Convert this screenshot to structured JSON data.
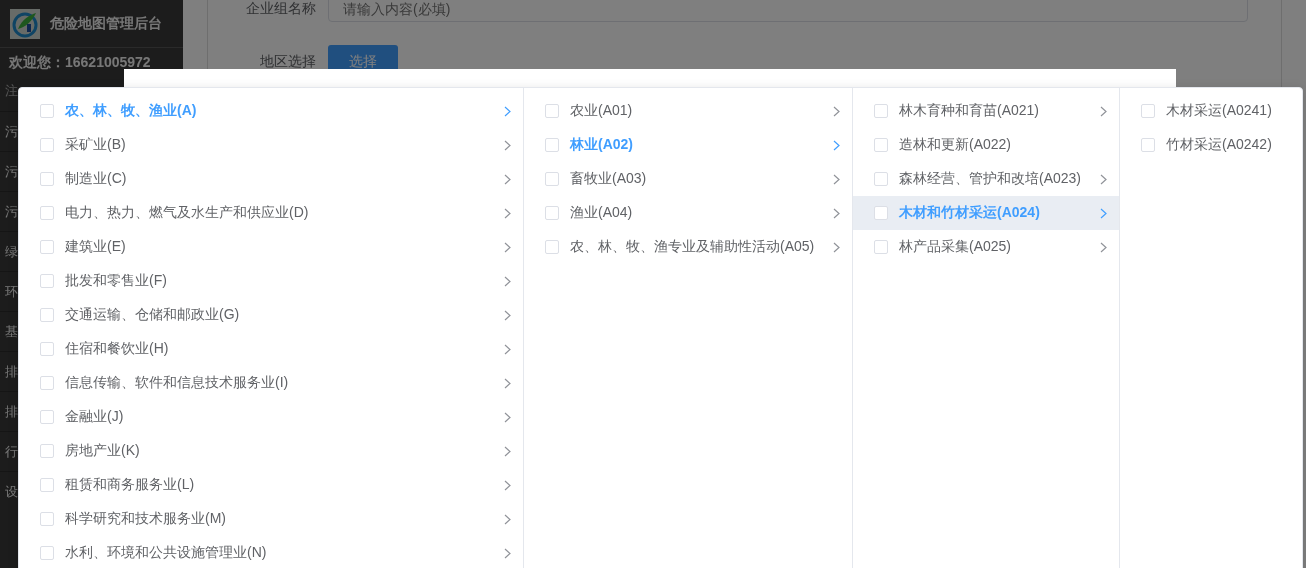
{
  "sidebar": {
    "title": "危险地图管理后台",
    "welcome": "欢迎您：16621005972",
    "note": "注",
    "items": [
      "污",
      "污",
      "污",
      "绿",
      "环",
      "基",
      "排",
      "排",
      "行",
      "设"
    ]
  },
  "form": {
    "name_label": "企业组名称",
    "name_placeholder": "请输入内容(必填)",
    "region_label": "地区选择",
    "region_button": "选择"
  },
  "cascader": {
    "columns": [
      [
        {
          "label": "农、林、牧、渔业(A)",
          "kind": "branch",
          "checked": false,
          "expanded": true,
          "highlighted": false
        },
        {
          "label": "采矿业(B)",
          "kind": "branch",
          "checked": false,
          "expanded": false,
          "highlighted": false
        },
        {
          "label": "制造业(C)",
          "kind": "branch",
          "checked": false,
          "expanded": false,
          "highlighted": false
        },
        {
          "label": "电力、热力、燃气及水生产和供应业(D)",
          "kind": "branch",
          "checked": false,
          "expanded": false,
          "highlighted": false
        },
        {
          "label": "建筑业(E)",
          "kind": "branch",
          "checked": false,
          "expanded": false,
          "highlighted": false
        },
        {
          "label": "批发和零售业(F)",
          "kind": "branch",
          "checked": false,
          "expanded": false,
          "highlighted": false
        },
        {
          "label": "交通运输、仓储和邮政业(G)",
          "kind": "branch",
          "checked": false,
          "expanded": false,
          "highlighted": false
        },
        {
          "label": "住宿和餐饮业(H)",
          "kind": "branch",
          "checked": false,
          "expanded": false,
          "highlighted": false
        },
        {
          "label": "信息传输、软件和信息技术服务业(I)",
          "kind": "branch",
          "checked": false,
          "expanded": false,
          "highlighted": false
        },
        {
          "label": "金融业(J)",
          "kind": "branch",
          "checked": false,
          "expanded": false,
          "highlighted": false
        },
        {
          "label": "房地产业(K)",
          "kind": "branch",
          "checked": false,
          "expanded": false,
          "highlighted": false
        },
        {
          "label": "租赁和商务服务业(L)",
          "kind": "branch",
          "checked": false,
          "expanded": false,
          "highlighted": false
        },
        {
          "label": "科学研究和技术服务业(M)",
          "kind": "branch",
          "checked": false,
          "expanded": false,
          "highlighted": false
        },
        {
          "label": "水利、环境和公共设施管理业(N)",
          "kind": "branch",
          "checked": false,
          "expanded": false,
          "highlighted": false
        }
      ],
      [
        {
          "label": "农业(A01)",
          "kind": "branch",
          "checked": false,
          "expanded": false,
          "highlighted": false
        },
        {
          "label": "林业(A02)",
          "kind": "branch",
          "checked": false,
          "expanded": true,
          "highlighted": false
        },
        {
          "label": "畜牧业(A03)",
          "kind": "branch",
          "checked": false,
          "expanded": false,
          "highlighted": false
        },
        {
          "label": "渔业(A04)",
          "kind": "branch",
          "checked": false,
          "expanded": false,
          "highlighted": false
        },
        {
          "label": "农、林、牧、渔专业及辅助性活动(A05)",
          "kind": "branch",
          "checked": false,
          "expanded": false,
          "highlighted": false
        }
      ],
      [
        {
          "label": "林木育种和育苗(A021)",
          "kind": "branch",
          "checked": false,
          "expanded": false,
          "highlighted": false
        },
        {
          "label": "造林和更新(A022)",
          "kind": "leaf",
          "checked": false,
          "expanded": false,
          "highlighted": false
        },
        {
          "label": "森林经营、管护和改培(A023)",
          "kind": "branch",
          "checked": false,
          "expanded": false,
          "highlighted": false
        },
        {
          "label": "木材和竹材采运(A024)",
          "kind": "branch",
          "checked": false,
          "expanded": true,
          "highlighted": true
        },
        {
          "label": "林产品采集(A025)",
          "kind": "branch",
          "checked": false,
          "expanded": false,
          "highlighted": false
        }
      ],
      [
        {
          "label": "木材采运(A0241)",
          "kind": "leaf",
          "checked": false,
          "expanded": false,
          "highlighted": false
        },
        {
          "label": "竹材采运(A0242)",
          "kind": "leaf",
          "checked": false,
          "expanded": false,
          "highlighted": false
        }
      ]
    ]
  }
}
